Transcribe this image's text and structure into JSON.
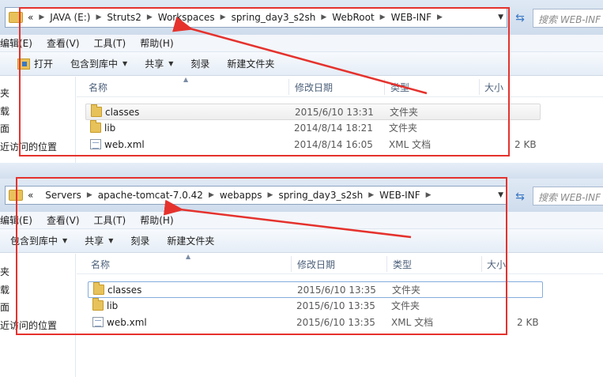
{
  "windows": [
    {
      "address": {
        "chevron": "«",
        "crumbs": [
          "JAVA (E:)",
          "Struts2",
          "Workspaces",
          "spring_day3_s2sh",
          "WebRoot",
          "WEB-INF"
        ],
        "search_placeholder": "搜索 WEB-INF"
      },
      "menu": [
        "编辑(E)",
        "查看(V)",
        "工具(T)",
        "帮助(H)"
      ],
      "toolbar": [
        "打开",
        "包含到库中",
        "共享",
        "刻录",
        "新建文件夹"
      ],
      "nav": [
        "夹",
        "载",
        "面",
        "近访问的位置"
      ],
      "columns": [
        "名称",
        "修改日期",
        "类型",
        "大小"
      ],
      "files": [
        {
          "name": "classes",
          "date": "2015/6/10 13:31",
          "type": "文件夹",
          "size": ""
        },
        {
          "name": "lib",
          "date": "2014/8/14 18:21",
          "type": "文件夹",
          "size": ""
        },
        {
          "name": "web.xml",
          "date": "2014/8/14 16:05",
          "type": "XML 文档",
          "size": "2 KB"
        }
      ]
    },
    {
      "address": {
        "chevron": "«",
        "crumbs": [
          "Servers",
          "apache-tomcat-7.0.42",
          "webapps",
          "spring_day3_s2sh",
          "WEB-INF"
        ],
        "search_placeholder": "搜索 WEB-INF"
      },
      "menu": [
        "编辑(E)",
        "查看(V)",
        "工具(T)",
        "帮助(H)"
      ],
      "toolbar": [
        "包含到库中",
        "共享",
        "刻录",
        "新建文件夹"
      ],
      "nav": [
        "夹",
        "载",
        "面",
        "近访问的位置"
      ],
      "columns": [
        "名称",
        "修改日期",
        "类型",
        "大小"
      ],
      "files": [
        {
          "name": "classes",
          "date": "2015/6/10 13:35",
          "type": "文件夹",
          "size": ""
        },
        {
          "name": "lib",
          "date": "2015/6/10 13:35",
          "type": "文件夹",
          "size": ""
        },
        {
          "name": "web.xml",
          "date": "2015/6/10 13:35",
          "type": "XML 文档",
          "size": "2 KB"
        }
      ]
    }
  ],
  "icons": {
    "folder": "folder-icon",
    "xml": "xml-file-icon",
    "refresh": "refresh-icon",
    "dropdown": "chevron-down-icon",
    "separator": "chevron-right-icon"
  },
  "colors": {
    "annotation": "#e5322d",
    "address_border": "#8ea4c1",
    "folder": "#e7c25b"
  }
}
